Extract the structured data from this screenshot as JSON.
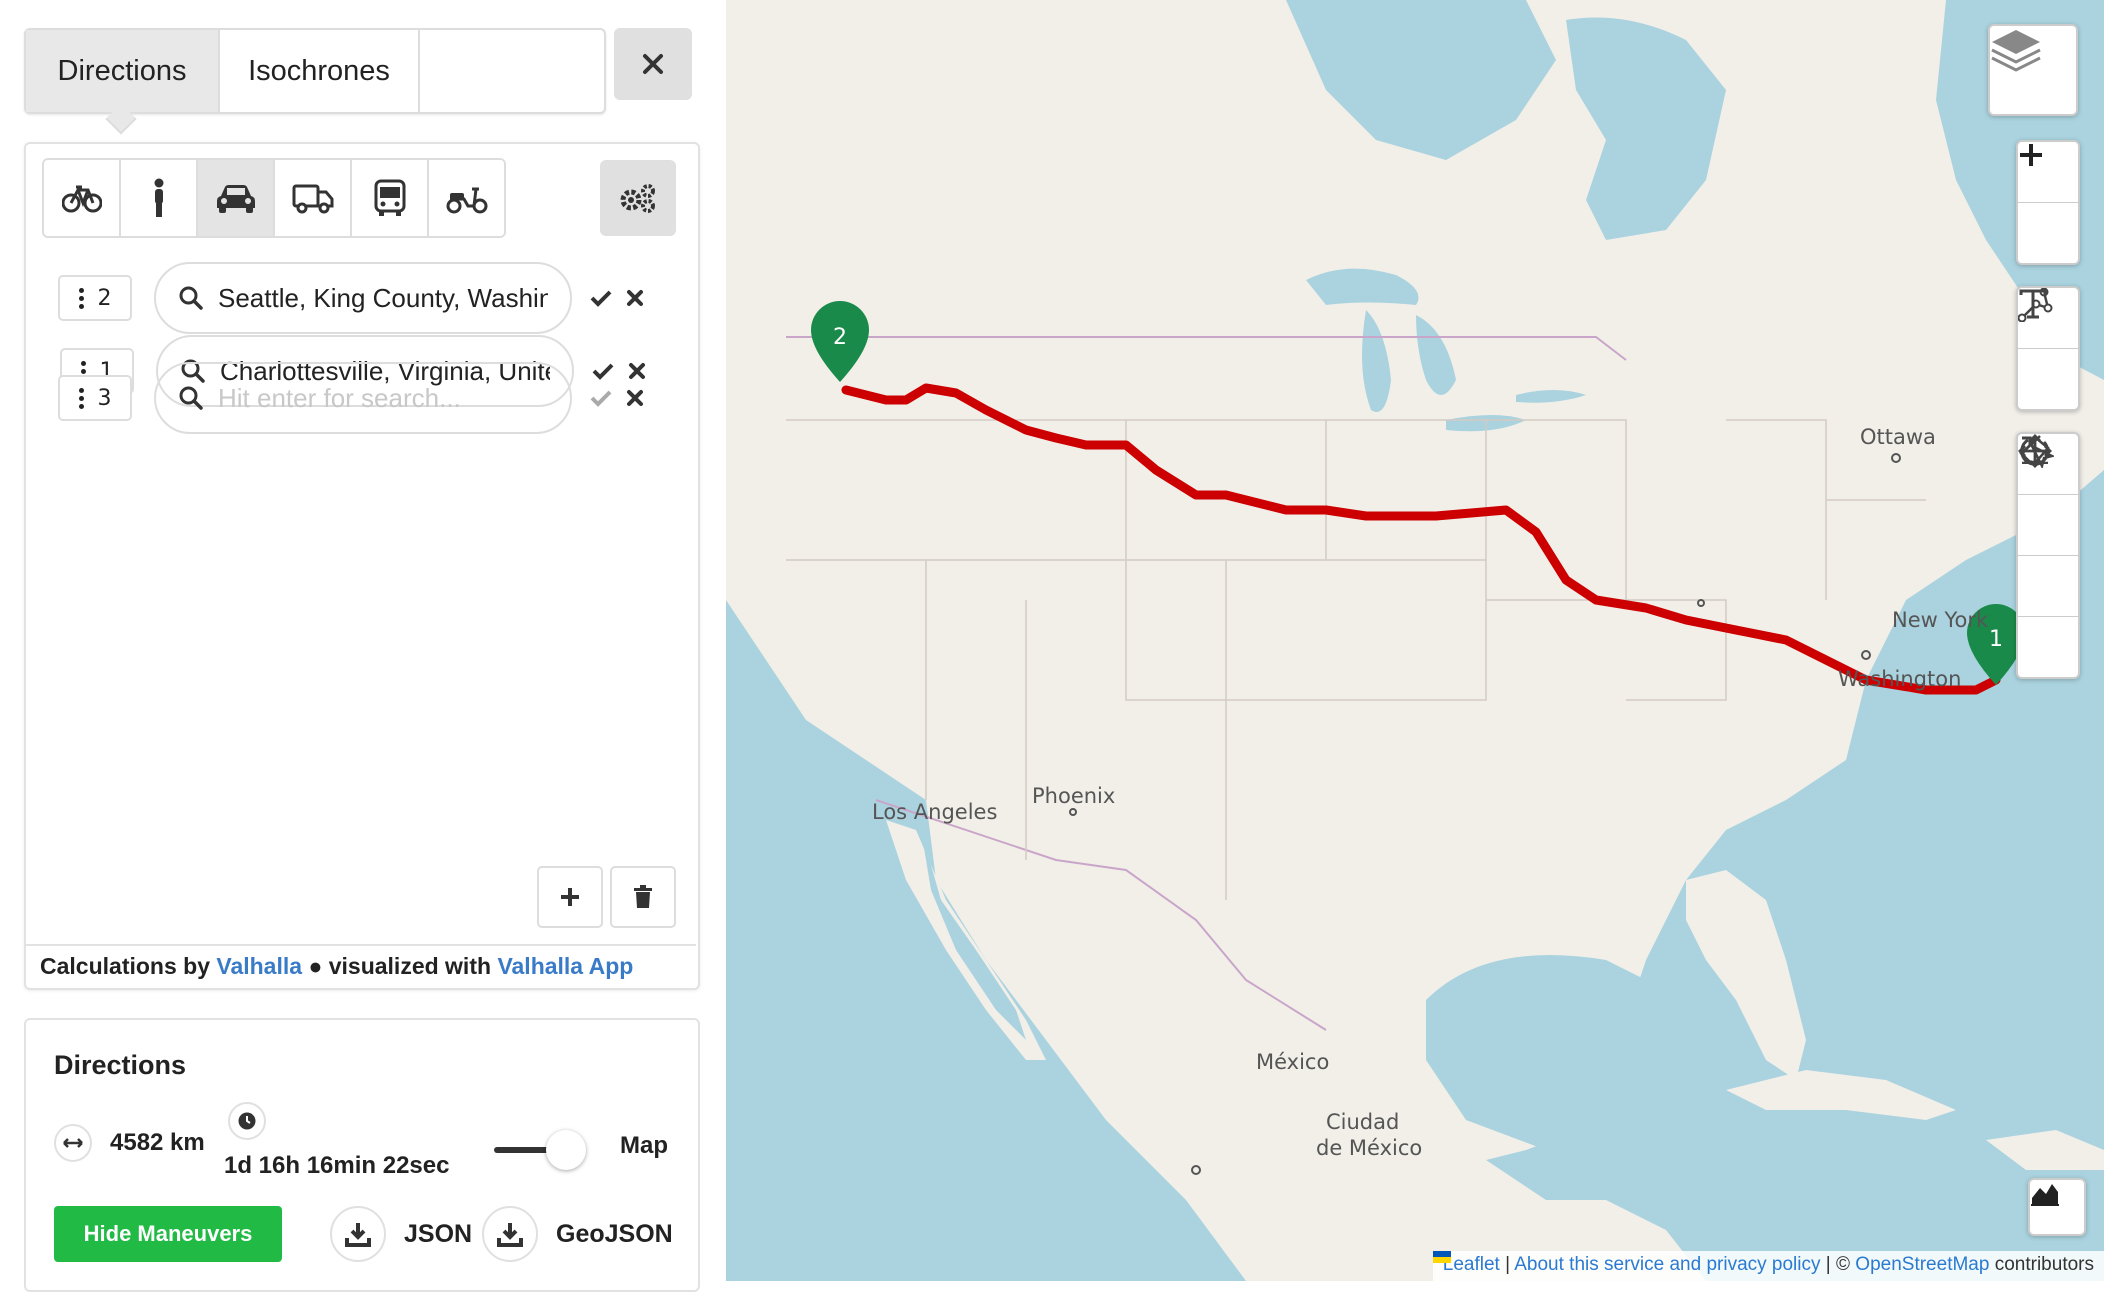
{
  "tabs": [
    "Directions",
    "Isochrones"
  ],
  "waypoints": [
    {
      "num": "1",
      "value": "Charlottesville, Virginia, United States"
    },
    {
      "num": "2",
      "value": "Seattle, King County, Washington"
    },
    {
      "num": "3",
      "value": ""
    }
  ],
  "search_placeholder": "Hit enter for search...",
  "credits": {
    "prefix": "Calculations by",
    "engine_link": "Valhalla",
    "middle": "● visualized with",
    "app_link": "Valhalla App"
  },
  "directions": {
    "title": "Directions",
    "distance": "4582 km",
    "duration": "1d 16h 16min 22sec",
    "toggle_label": "Map",
    "hide_button": "Hide Maneuvers",
    "json_label": "JSON",
    "geojson_label": "GeoJSON"
  },
  "map": {
    "labels": {
      "ottawa": "Ottawa",
      "new_york": "New York",
      "washington": "Washington",
      "los_angeles": "Los Angeles",
      "phoenix": "Phoenix",
      "mexico": "México",
      "ciudad1": "Ciudad",
      "ciudad2": "de México"
    },
    "markers": [
      "1",
      "2"
    ],
    "route_color": "#cc0000",
    "marker_color": "#1a8a4a"
  },
  "attribution": {
    "leaflet": "Leaflet",
    "privacy": "About this service and privacy policy",
    "osm_prefix": "©",
    "osm": "OpenStreetMap",
    "contributors": "contributors"
  }
}
